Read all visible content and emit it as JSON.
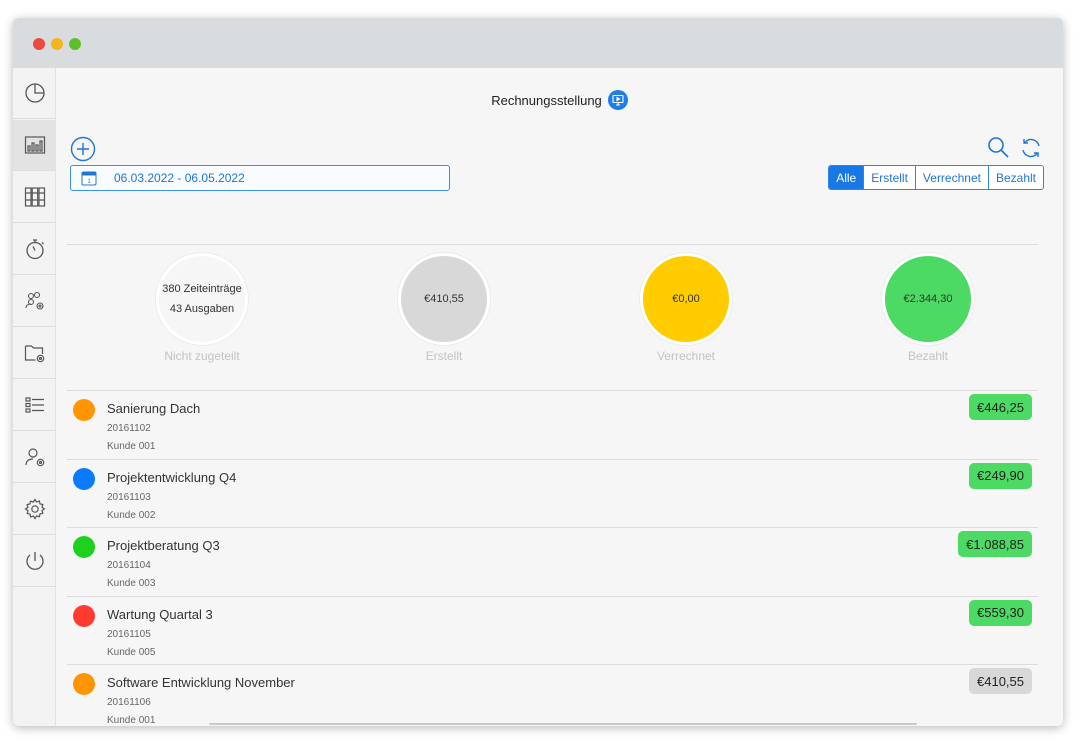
{
  "header": {
    "title": "Rechnungsstellung",
    "date_range": "06.03.2022 - 06.05.2022"
  },
  "filters": {
    "all": "Alle",
    "created": "Erstellt",
    "billed": "Verrechnet",
    "paid": "Bezahlt",
    "active": "Alle"
  },
  "stats": [
    {
      "line1": "380 Zeiteinträge",
      "line2": "43 Ausgaben",
      "label": "Nicht zugeteilt",
      "color": "#f6f6f6"
    },
    {
      "value": "€410,55",
      "label": "Erstellt",
      "color": "#d8d8d8"
    },
    {
      "value": "€0,00",
      "label": "Verrechnet",
      "color": "#ffcc00"
    },
    {
      "value": "€2.344,30",
      "label": "Bezahlt",
      "color": "#4cd964"
    }
  ],
  "invoices": [
    {
      "title": "Sanierung Dach",
      "number": "20161102",
      "client": "Kunde 001",
      "amount": "€446,25",
      "dot_color": "#ff9500",
      "amount_color": "#4cd964"
    },
    {
      "title": "Projektentwicklung Q4",
      "number": "20161103",
      "client": "Kunde 002",
      "amount": "€249,90",
      "dot_color": "#0a7aff",
      "amount_color": "#4cd964"
    },
    {
      "title": "Projektberatung Q3",
      "number": "20161104",
      "client": "Kunde 003",
      "amount": "€1.088,85",
      "dot_color": "#1fd11f",
      "amount_color": "#4cd964"
    },
    {
      "title": "Wartung Quartal 3",
      "number": "20161105",
      "client": "Kunde 005",
      "amount": "€559,30",
      "dot_color": "#ff3b30",
      "amount_color": "#4cd964"
    },
    {
      "title": "Software Entwicklung November",
      "number": "20161106",
      "client": "Kunde 001",
      "amount": "€410,55",
      "dot_color": "#ff9500",
      "amount_color": "#d8d8d8"
    }
  ],
  "sidebar": [
    {
      "icon": "pie-chart-icon"
    },
    {
      "icon": "bar-chart-icon"
    },
    {
      "icon": "binders-icon"
    },
    {
      "icon": "stopwatch-icon"
    },
    {
      "icon": "team-settings-icon"
    },
    {
      "icon": "folder-settings-icon"
    },
    {
      "icon": "list-icon"
    },
    {
      "icon": "user-settings-icon"
    },
    {
      "icon": "gear-icon"
    },
    {
      "icon": "power-icon"
    }
  ],
  "colors": {
    "accent": "#1878e6"
  }
}
